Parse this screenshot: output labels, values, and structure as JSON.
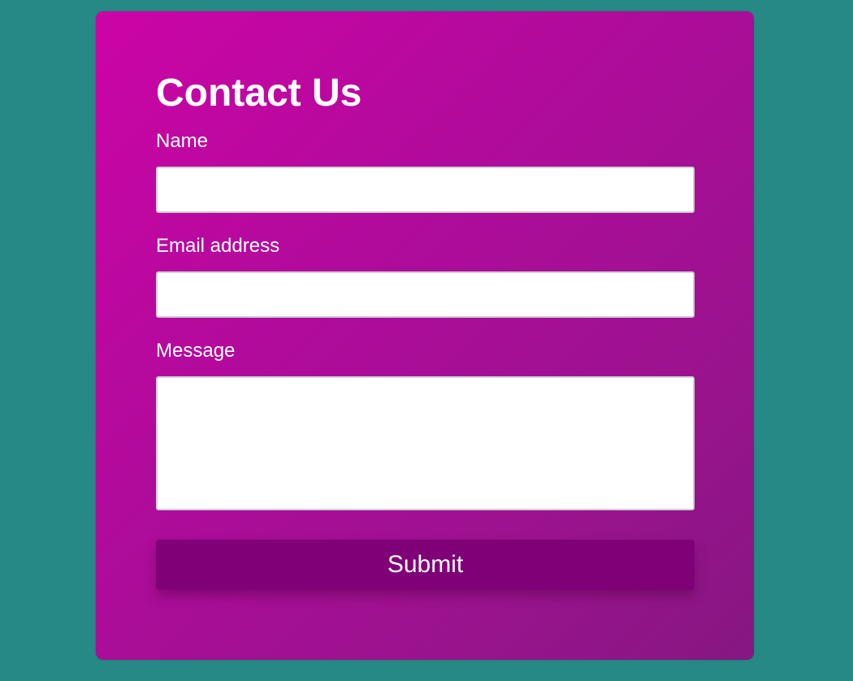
{
  "form": {
    "title": "Contact Us",
    "fields": {
      "name": {
        "label": "Name",
        "value": ""
      },
      "email": {
        "label": "Email address",
        "value": ""
      },
      "message": {
        "label": "Message",
        "value": ""
      }
    },
    "submit_label": "Submit"
  },
  "colors": {
    "page_background": "#278985",
    "card_gradient_start": "#cc04a6",
    "card_gradient_end": "#861781",
    "submit_button": "#800078",
    "text": "#ffffff"
  }
}
